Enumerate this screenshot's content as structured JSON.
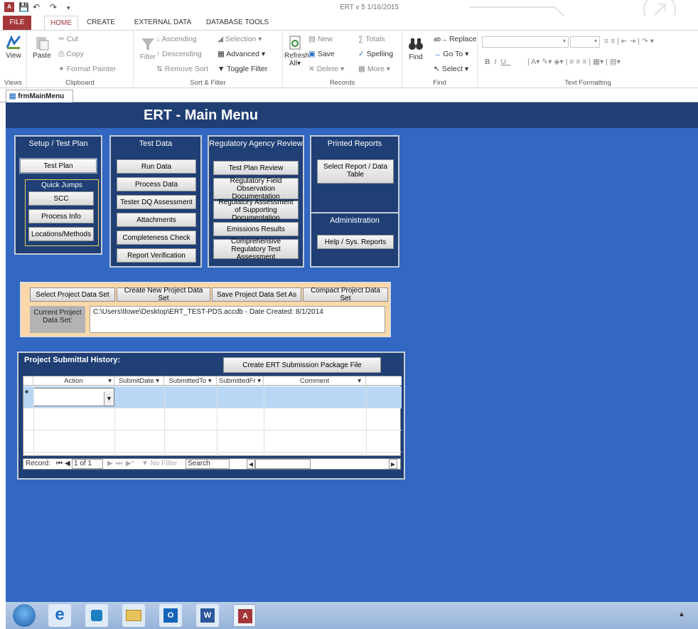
{
  "window": {
    "title": "ERT v 5 1/16/2015"
  },
  "ribbon_tabs": [
    "FILE",
    "HOME",
    "CREATE",
    "EXTERNAL DATA",
    "DATABASE TOOLS"
  ],
  "ribbon": {
    "views": {
      "view_label": "View",
      "group": "Views"
    },
    "clipboard": {
      "paste": "Paste",
      "cut": "Cut",
      "copy": "Copy",
      "format_painter": "Format Painter",
      "group": "Clipboard"
    },
    "sort_filter": {
      "filter": "Filter",
      "ascending": "Ascending",
      "descending": "Descending",
      "remove_sort": "Remove Sort",
      "selection": "Selection",
      "advanced": "Advanced",
      "toggle_filter": "Toggle Filter",
      "group": "Sort & Filter"
    },
    "records": {
      "refresh": "Refresh",
      "refresh_sub": "All",
      "new": "New",
      "save": "Save",
      "delete": "Delete",
      "totals": "Totals",
      "spelling": "Spelling",
      "more": "More",
      "group": "Records"
    },
    "find": {
      "find": "Find",
      "replace": "Replace",
      "goto": "Go To",
      "select": "Select",
      "group": "Find"
    },
    "text_formatting": {
      "group": "Text Formatting"
    }
  },
  "doc_tab": "frmMainMenu",
  "form": {
    "title": "ERT - Main Menu",
    "setup": {
      "title": "Setup / Test Plan",
      "test_plan": "Test Plan",
      "quick_jumps": "Quick Jumps",
      "scc": "SCC",
      "process_info": "Process Info",
      "locations": "Locations/Methods"
    },
    "test_data": {
      "title": "Test Data",
      "run_data": "Run Data",
      "process_data": "Process Data",
      "tester_dq": "Tester DQ Assessment",
      "attachments": "Attachments",
      "completeness": "Completeness Check",
      "report_verification": "Report Verification"
    },
    "regulatory": {
      "title": "Regulatory Agency Review",
      "test_plan_review": "Test Plan Review",
      "field_obs": "Regulatory Field Observation Documentation",
      "assessment": "Regulatory Assessment of Supporting Documentation",
      "emissions": "Emissions Results",
      "comprehensive": "Comprehensive Regulatory Test Assessment"
    },
    "reports": {
      "title": "Printed Reports",
      "select_report": "Select Report / Data Table"
    },
    "admin": {
      "title": "Administration",
      "help": "Help / Sys. Reports"
    },
    "project": {
      "select": "Select Project Data Set",
      "create": "Create New Project Data Set",
      "save_as": "Save Project Data Set As",
      "compact": "Compact Project Data Set",
      "current_label": "Current Project Data Set:",
      "current_value": "C:\\Users\\tlowe\\Desktop\\ERT_TEST-PDS.accdb - Date Created: 8/1/2014"
    },
    "history": {
      "title": "Project Submittal History:",
      "create_package": "Create ERT Submission Package File",
      "columns": [
        "Action",
        "SubmitDate",
        "SubmittedTo",
        "SubmittedFr",
        "Comment"
      ],
      "new_row_marker": "*",
      "nav": {
        "record_label": "Record:",
        "position": "1 of 1",
        "no_filter": "No Filter",
        "search": "Search"
      }
    }
  },
  "colors": {
    "form_bg": "#3267c2",
    "panel_bg": "#1f3f75",
    "access_red": "#a4373a"
  }
}
